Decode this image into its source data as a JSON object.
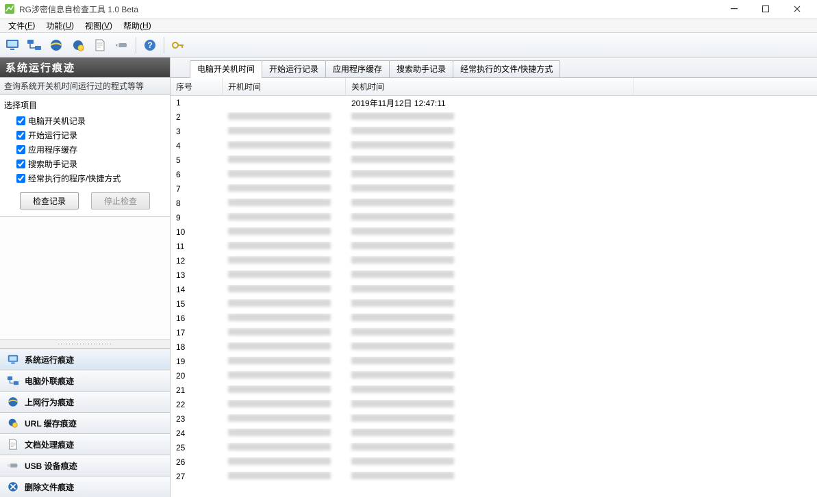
{
  "window": {
    "title": "RG涉密信息自检查工具 1.0 Beta"
  },
  "menus": {
    "file": {
      "label_pre": "文件(",
      "hot": "F",
      "label_post": ")"
    },
    "func": {
      "label_pre": "功能(",
      "hot": "U",
      "label_post": ")"
    },
    "view": {
      "label_pre": "视图(",
      "hot": "V",
      "label_post": ")"
    },
    "help": {
      "label_pre": "帮助(",
      "hot": "H",
      "label_post": ")"
    }
  },
  "sidebar": {
    "header": "系统运行痕迹",
    "desc": "查询系统开关机时间运行过的程式等等",
    "group_label": "选择项目",
    "checks": [
      {
        "label": "电脑开关机记录",
        "checked": true
      },
      {
        "label": "开始运行记录",
        "checked": true
      },
      {
        "label": "应用程序缓存",
        "checked": true
      },
      {
        "label": "搜索助手记录",
        "checked": true
      },
      {
        "label": "经常执行的程序/快捷方式",
        "checked": true
      }
    ],
    "btn_check": "检查记录",
    "btn_stop": "停止检查"
  },
  "nav": [
    {
      "label": "系统运行痕迹",
      "active": true
    },
    {
      "label": "电脑外联痕迹",
      "active": false
    },
    {
      "label": "上网行为痕迹",
      "active": false
    },
    {
      "label": "URL 缓存痕迹",
      "active": false
    },
    {
      "label": "文档处理痕迹",
      "active": false
    },
    {
      "label": "USB 设备痕迹",
      "active": false
    },
    {
      "label": "删除文件痕迹",
      "active": false
    }
  ],
  "tabs": [
    {
      "label": "电脑开关机时间",
      "active": true
    },
    {
      "label": "开始运行记录",
      "active": false
    },
    {
      "label": "应用程序缓存",
      "active": false
    },
    {
      "label": "搜索助手记录",
      "active": false
    },
    {
      "label": "经常执行的文件/快捷方式",
      "active": false
    }
  ],
  "table": {
    "cols": {
      "idx": "序号",
      "on": "开机时间",
      "off": "关机时间"
    },
    "rows": [
      {
        "idx": "1",
        "on": "",
        "off": "2019年11月12日 12:47:11"
      },
      {
        "idx": "2",
        "on": "[blur]",
        "off": "[blur]"
      },
      {
        "idx": "3",
        "on": "[blur]",
        "off": "[blur]"
      },
      {
        "idx": "4",
        "on": "[blur]",
        "off": "[blur]"
      },
      {
        "idx": "5",
        "on": "[blur]",
        "off": "[blur]"
      },
      {
        "idx": "6",
        "on": "[blur]",
        "off": "[blur]"
      },
      {
        "idx": "7",
        "on": "[blur]",
        "off": "[blur]"
      },
      {
        "idx": "8",
        "on": "[blur]",
        "off": "[blur]"
      },
      {
        "idx": "9",
        "on": "[blur]",
        "off": "[blur]"
      },
      {
        "idx": "10",
        "on": "[blur]",
        "off": "[blur]"
      },
      {
        "idx": "11",
        "on": "[blur]",
        "off": "[blur]"
      },
      {
        "idx": "12",
        "on": "[blur]",
        "off": "[blur]"
      },
      {
        "idx": "13",
        "on": "[blur]",
        "off": "[blur]"
      },
      {
        "idx": "14",
        "on": "[blur]",
        "off": "[blur]"
      },
      {
        "idx": "15",
        "on": "[blur]",
        "off": "[blur]"
      },
      {
        "idx": "16",
        "on": "[blur]",
        "off": "[blur]"
      },
      {
        "idx": "17",
        "on": "[blur]",
        "off": "[blur]"
      },
      {
        "idx": "18",
        "on": "[blur]",
        "off": "[blur]"
      },
      {
        "idx": "19",
        "on": "[blur]",
        "off": "[blur]"
      },
      {
        "idx": "20",
        "on": "[blur]",
        "off": "[blur]"
      },
      {
        "idx": "21",
        "on": "[blur]",
        "off": "[blur]"
      },
      {
        "idx": "22",
        "on": "[blur]",
        "off": "[blur]"
      },
      {
        "idx": "23",
        "on": "[blur]",
        "off": "[blur]"
      },
      {
        "idx": "24",
        "on": "[blur]",
        "off": "[blur]"
      },
      {
        "idx": "25",
        "on": "[blur]",
        "off": "[blur]"
      },
      {
        "idx": "26",
        "on": "[blur]",
        "off": "[blur]"
      },
      {
        "idx": "27",
        "on": "[blur]",
        "off": "[blur]"
      }
    ]
  },
  "colors": {
    "accent": "#2d6fb7"
  }
}
